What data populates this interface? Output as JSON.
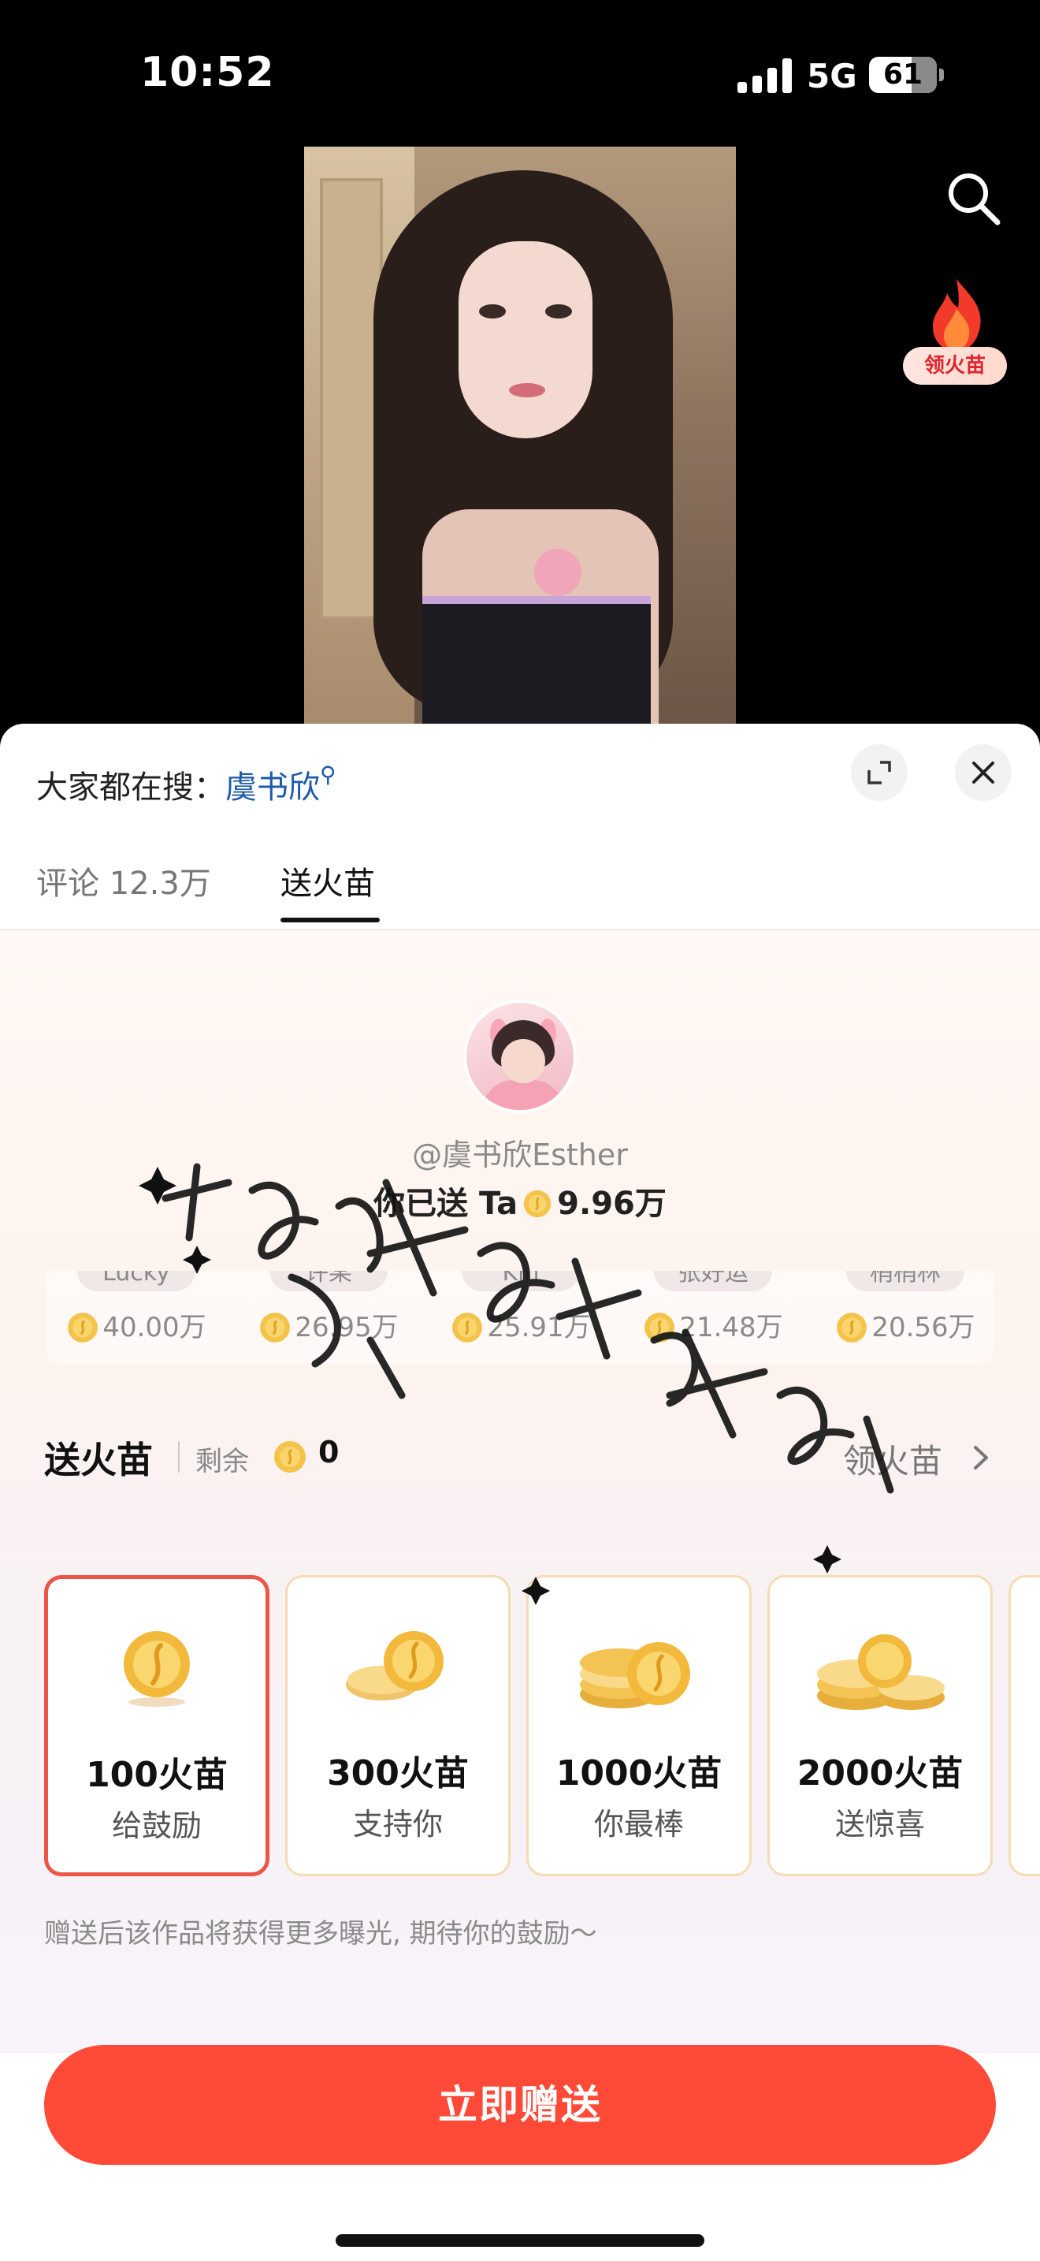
{
  "status": {
    "time": "10:52",
    "network": "5G",
    "battery": "61"
  },
  "side": {
    "flame_label": "领火苗"
  },
  "sheet": {
    "trending_prefix": "大家都在搜：",
    "trending_keyword": "虞书欣",
    "tabs": [
      {
        "label": "评论 12.3万",
        "active": false
      },
      {
        "label": "送火苗",
        "active": true
      }
    ],
    "creator": {
      "handle": "@虞书欣Esther",
      "sent_prefix": "你已送 Ta",
      "sent_amount": "9.96万"
    },
    "ranking": [
      {
        "name": "Lucky",
        "amount": "40.00万"
      },
      {
        "name": "许某",
        "amount": "26.95万"
      },
      {
        "name": "Kin",
        "amount": "25.91万"
      },
      {
        "name": "张好运",
        "amount": "21.48万"
      },
      {
        "name": "梢梢林",
        "amount": "20.56万"
      }
    ],
    "send_section": {
      "title": "送火苗",
      "remain_label": "剩余",
      "remain_value": "0",
      "claim_label": "领火苗"
    },
    "gifts": [
      {
        "amount": "100火苗",
        "desc": "给鼓励",
        "selected": true
      },
      {
        "amount": "300火苗",
        "desc": "支持你",
        "selected": false
      },
      {
        "amount": "1000火苗",
        "desc": "你最棒",
        "selected": false
      },
      {
        "amount": "2000火苗",
        "desc": "送惊喜",
        "selected": false
      }
    ],
    "hint": "赠送后该作品将获得更多曝光, 期待你的鼓励～",
    "cta": "立即赠送"
  },
  "colors": {
    "accent": "#ff4a38",
    "selected_border": "#ec5446",
    "coin": "#f5c24a",
    "link": "#1e5aa8"
  }
}
